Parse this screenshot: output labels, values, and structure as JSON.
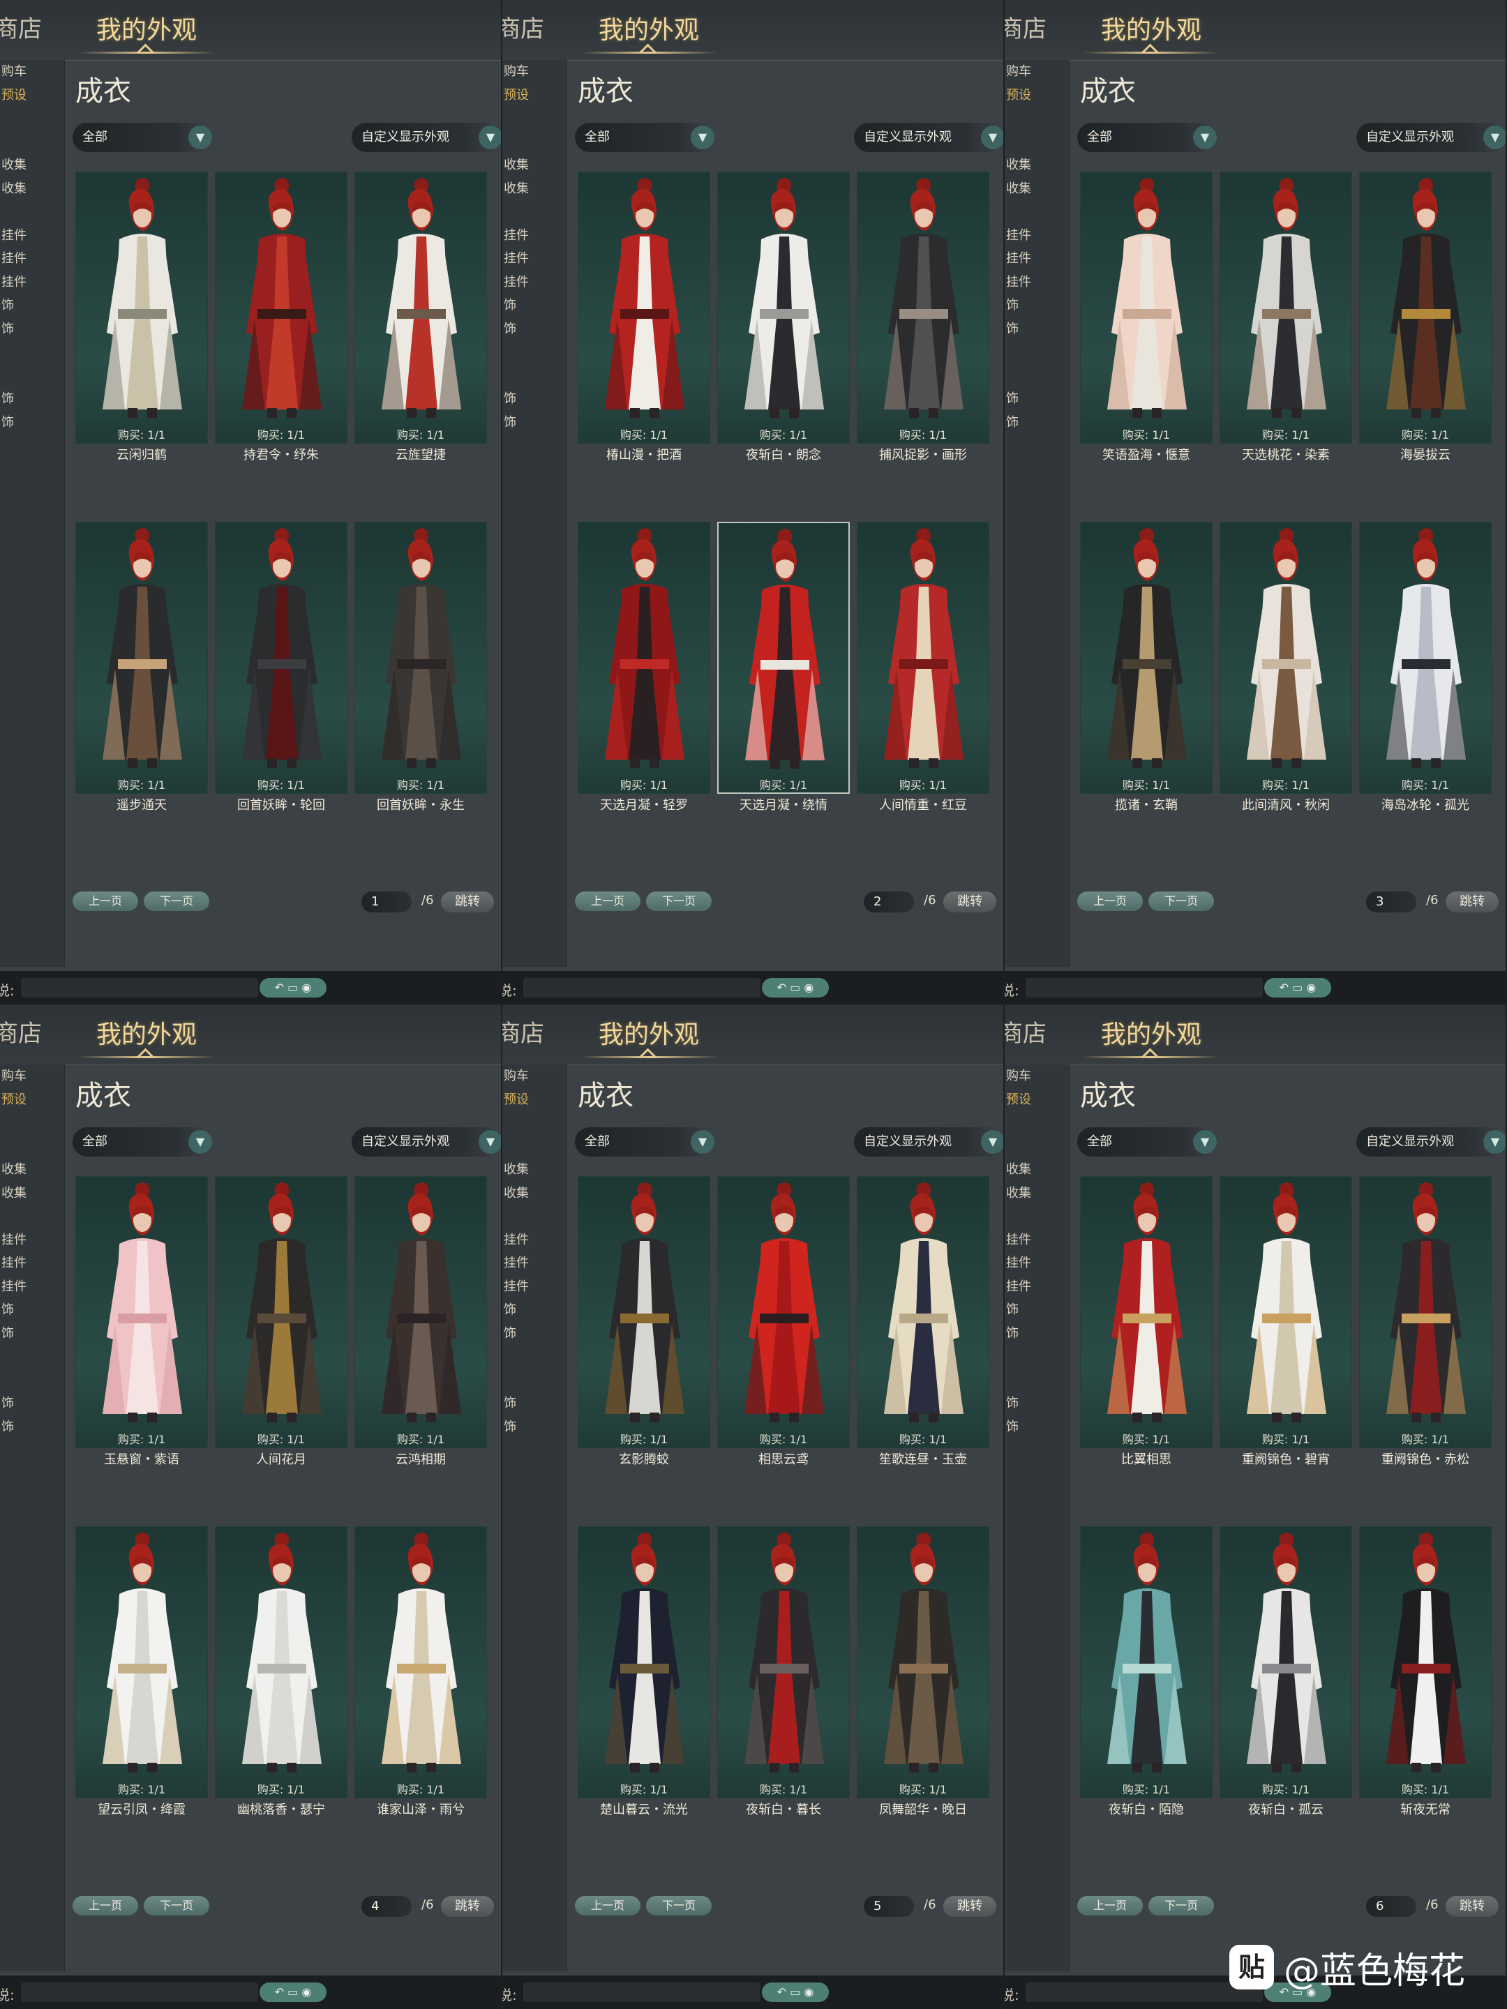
{
  "header": {
    "shop_tab": "商店",
    "my_tab": "我的外观"
  },
  "section_title": "成衣",
  "filters": {
    "all": "全部",
    "custom": "自定义显示外观"
  },
  "pager": {
    "prev": "上一页",
    "next": "下一页",
    "jump": "跳转",
    "total": "/6"
  },
  "chat": {
    "label": "说:",
    "icons": "↶ ▭ ◉"
  },
  "watermark": {
    "logo": "贴",
    "text": "@蓝色梅花"
  },
  "sidebar_items": [
    "购车",
    "预设",
    "",
    "",
    "收集",
    "收集",
    "",
    "挂件",
    "挂件",
    "挂件",
    "饰",
    "饰",
    "",
    "",
    "饰",
    "饰",
    "",
    "",
    "",
    "",
    "",
    "",
    "",
    ""
  ],
  "panels": [
    {
      "page": "1",
      "cards": [
        {
          "name": "云闲归鹤",
          "buy": "购买: 1/1",
          "colors": [
            "#e9e7e0",
            "#c9c2a8",
            "#8a8a7a"
          ]
        },
        {
          "name": "持君令・纾朱",
          "buy": "购买: 1/1",
          "colors": [
            "#9a1f1f",
            "#c23a2a",
            "#3a1a16"
          ]
        },
        {
          "name": "云旌望捷",
          "buy": "购买: 1/1",
          "colors": [
            "#ece9e3",
            "#b9322a",
            "#6c5a4a"
          ]
        },
        {
          "name": "遥步通天",
          "buy": "购买: 1/1",
          "colors": [
            "#2a2b2c",
            "#6a4f3c",
            "#c7a37a"
          ]
        },
        {
          "name": "回首妖眸・轮回",
          "buy": "购买: 1/1",
          "colors": [
            "#2b2c2e",
            "#5a1616",
            "#3b3d40"
          ]
        },
        {
          "name": "回首妖眸・永生",
          "buy": "购买: 1/1",
          "colors": [
            "#3a3634",
            "#5a5048",
            "#2a2625"
          ]
        }
      ]
    },
    {
      "page": "2",
      "cards": [
        {
          "name": "椿山漫・把酒",
          "buy": "购买: 1/1",
          "colors": [
            "#b4231f",
            "#f0ece6",
            "#5a1614"
          ]
        },
        {
          "name": "夜斩白・朗念",
          "buy": "购买: 1/1",
          "colors": [
            "#eeece8",
            "#2a2b2e",
            "#9c9a96"
          ]
        },
        {
          "name": "捕风捉影・画形",
          "buy": "购买: 1/1",
          "colors": [
            "#2c2b2d",
            "#505052",
            "#9a8d84"
          ]
        },
        {
          "name": "天选月凝・轻罗",
          "buy": "购买: 1/1",
          "colors": [
            "#8f1717",
            "#2a2022",
            "#c02a26"
          ]
        },
        {
          "name": "天选月凝・绕情",
          "buy": "购买: 1/1",
          "colors": [
            "#c4221f",
            "#2b2325",
            "#e8e4de"
          ],
          "selected": true
        },
        {
          "name": "人间情重・红豆",
          "buy": "购买: 1/1",
          "colors": [
            "#b52a28",
            "#e5d4b8",
            "#7a1a18"
          ]
        }
      ]
    },
    {
      "page": "3",
      "cards": [
        {
          "name": "笑语盈海・惬意",
          "buy": "购买: 1/1",
          "colors": [
            "#f0d6c8",
            "#e9e4dc",
            "#c9a894"
          ]
        },
        {
          "name": "天选桃花・染素",
          "buy": "购买: 1/1",
          "colors": [
            "#d7d5d2",
            "#2c2d30",
            "#8c7760"
          ]
        },
        {
          "name": "海晏拔云",
          "buy": "购买: 1/1",
          "colors": [
            "#242426",
            "#5a2f22",
            "#b3893c"
          ]
        },
        {
          "name": "揽诸・玄鞘",
          "buy": "购买: 1/1",
          "colors": [
            "#262627",
            "#b69a70",
            "#4a3f33"
          ]
        },
        {
          "name": "此间清风・秋闲",
          "buy": "购买: 1/1",
          "colors": [
            "#e8e2da",
            "#7a5a40",
            "#c8b7a0"
          ]
        },
        {
          "name": "海岛冰轮・孤光",
          "buy": "购买: 1/1",
          "colors": [
            "#e6e8ec",
            "#b8bcc6",
            "#2a2c34"
          ]
        }
      ]
    },
    {
      "page": "4",
      "cards": [
        {
          "name": "玉悬窗・紫语",
          "buy": "购买: 1/1",
          "colors": [
            "#f0c4c6",
            "#f6e4e4",
            "#d99ea4"
          ]
        },
        {
          "name": "人间花月",
          "buy": "购买: 1/1",
          "colors": [
            "#2c2a28",
            "#9c7a3a",
            "#5a4a3a"
          ]
        },
        {
          "name": "云鸿相期",
          "buy": "购买: 1/1",
          "colors": [
            "#3a302e",
            "#6a5a52",
            "#2a2426"
          ]
        },
        {
          "name": "望云引凤・绛霞",
          "buy": "购买: 1/1",
          "colors": [
            "#f2f2f0",
            "#d8d6d0",
            "#c4b088"
          ]
        },
        {
          "name": "幽桃落香・瑟宁",
          "buy": "购买: 1/1",
          "colors": [
            "#f0f0ee",
            "#dcdad6",
            "#b8b6b2"
          ]
        },
        {
          "name": "谁家山泽・雨兮",
          "buy": "购买: 1/1",
          "colors": [
            "#f2f0ec",
            "#d6cab0",
            "#c8a870"
          ]
        }
      ]
    },
    {
      "page": "5",
      "cards": [
        {
          "name": "玄影腾蛟",
          "buy": "购买: 1/1",
          "colors": [
            "#2a2a2c",
            "#d8d6d2",
            "#8a6a30"
          ]
        },
        {
          "name": "相思云鸢",
          "buy": "购买: 1/1",
          "colors": [
            "#d0241f",
            "#a81818",
            "#2a1e1e"
          ]
        },
        {
          "name": "笙歌连昼・玉壶",
          "buy": "购买: 1/1",
          "colors": [
            "#e6dcc4",
            "#2a2c40",
            "#b8a888"
          ]
        },
        {
          "name": "楚山暮云・流光",
          "buy": "购买: 1/1",
          "colors": [
            "#1e2230",
            "#e8e6e2",
            "#6a5a3a"
          ]
        },
        {
          "name": "夜斩白・暮长",
          "buy": "购买: 1/1",
          "colors": [
            "#2c2a2c",
            "#a81e1e",
            "#6a6060"
          ]
        },
        {
          "name": "凤舞韶华・晚日",
          "buy": "购买: 1/1",
          "colors": [
            "#2e2a28",
            "#6a5a46",
            "#8a7050"
          ]
        }
      ]
    },
    {
      "page": "6",
      "cards": [
        {
          "name": "比翼相思",
          "buy": "购买: 1/1",
          "colors": [
            "#b02020",
            "#f0ece6",
            "#c8a060"
          ]
        },
        {
          "name": "重阙锦色・碧宵",
          "buy": "购买: 1/1",
          "colors": [
            "#f0eeea",
            "#d2c8b0",
            "#c8a060"
          ]
        },
        {
          "name": "重阙锦色・赤松",
          "buy": "购买: 1/1",
          "colors": [
            "#2c2a2c",
            "#8a1e1e",
            "#c8a060"
          ]
        },
        {
          "name": "夜斩白・陌隐",
          "buy": "购买: 1/1",
          "colors": [
            "#6aa8a8",
            "#2a2e32",
            "#b8d8d4"
          ]
        },
        {
          "name": "夜斩白・孤云",
          "buy": "购买: 1/1",
          "colors": [
            "#e8e6e4",
            "#2a2a2e",
            "#8a8a8e"
          ]
        },
        {
          "name": "斩夜无常",
          "buy": "购买: 1/1",
          "colors": [
            "#1e1e20",
            "#f0f0ee",
            "#8a1e1e"
          ]
        }
      ]
    }
  ]
}
